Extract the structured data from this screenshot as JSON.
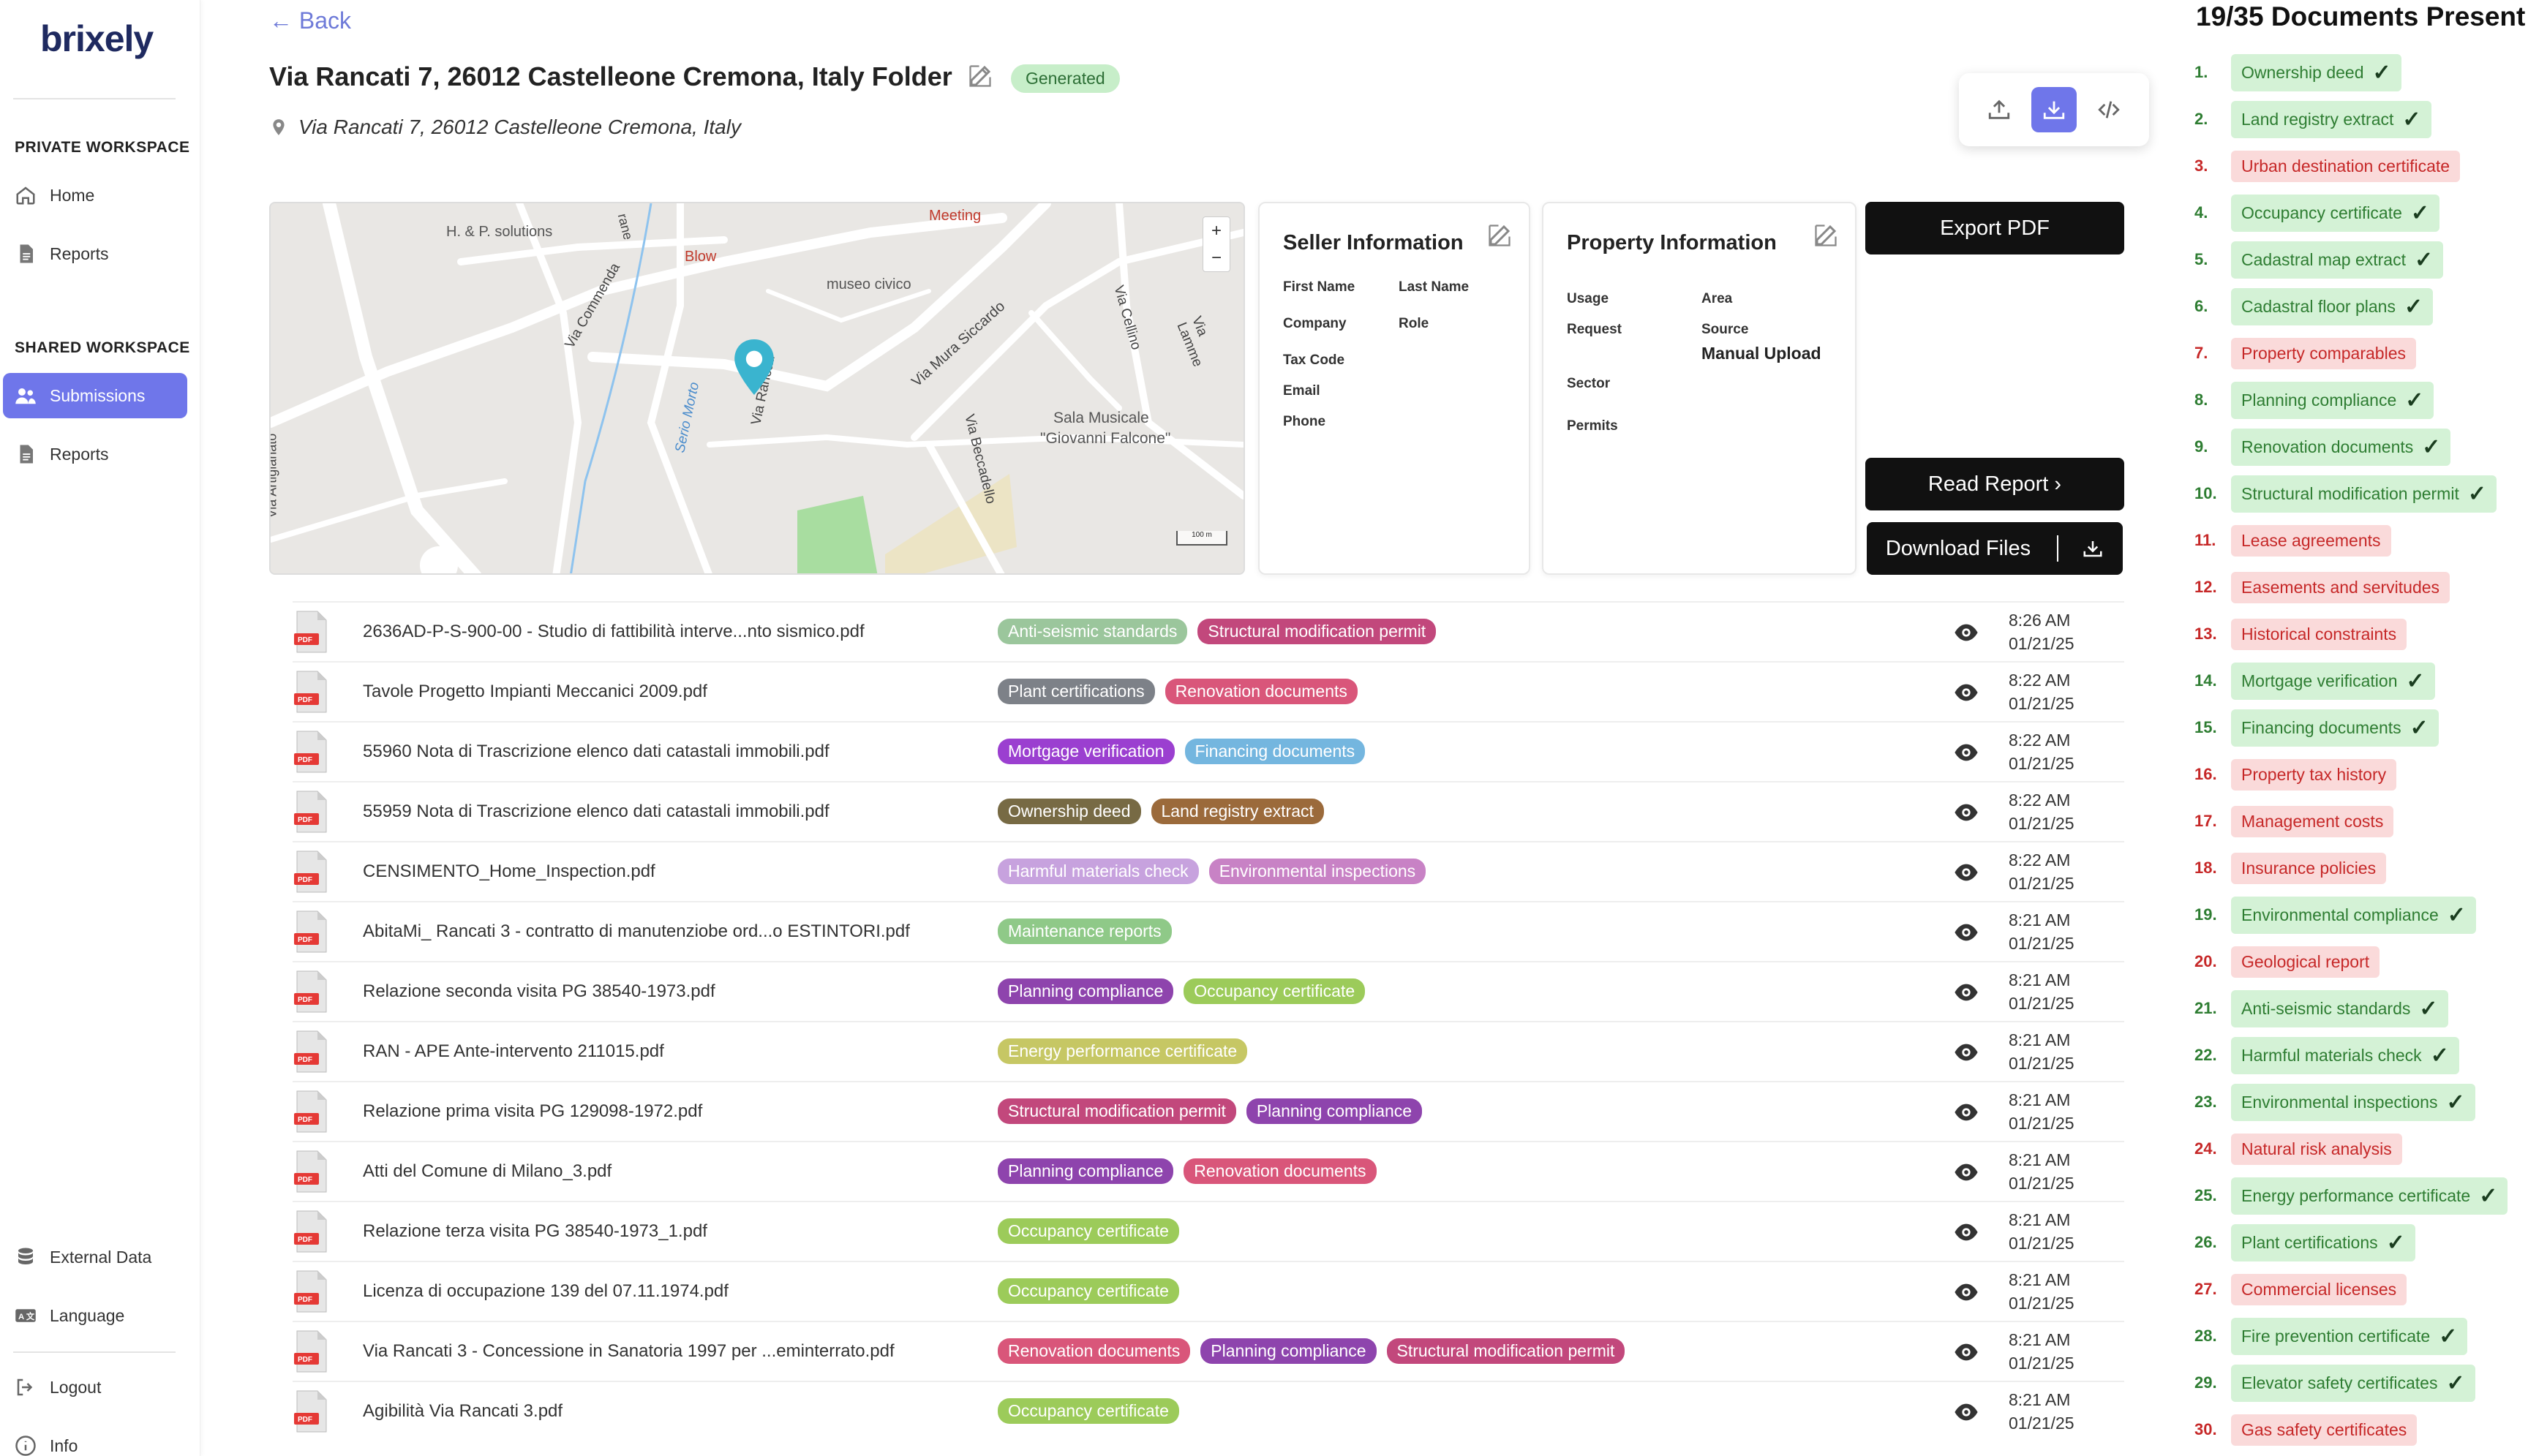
{
  "sidebar": {
    "logo": "brixely",
    "private_section": "PRIVATE WORKSPACE",
    "shared_section": "SHARED WORKSPACE",
    "items": [
      {
        "label": "Home",
        "icon": "home-icon"
      },
      {
        "label": "Reports",
        "icon": "document-icon"
      },
      {
        "label": "Submissions",
        "icon": "users-icon",
        "active": true
      },
      {
        "label": "Reports",
        "icon": "document-icon"
      }
    ],
    "bottom": [
      {
        "label": "External Data",
        "icon": "database-icon"
      },
      {
        "label": "Language",
        "icon": "translate-icon"
      },
      {
        "label": "Logout",
        "icon": "logout-icon"
      },
      {
        "label": "Info",
        "icon": "info-icon"
      }
    ]
  },
  "header": {
    "back": "← Back",
    "title": "Via Rancati 7, 26012 Castelleone Cremona, Italy Folder",
    "status": "Generated",
    "address": "Via Rancati 7, 26012 Castelleone Cremona, Italy"
  },
  "map_labels": {
    "poi1": "H. & P. solutions",
    "poi2": "Blow",
    "poi3": "Meeting",
    "poi4": "museo civico",
    "poi5": "Sala Musicale",
    "poi6": "\"Giovanni Falcone\"",
    "street1": "Via Commenda",
    "street2": "Seriо Morto",
    "street3": "Via Rancati",
    "street4": "Via Mura Siccardo",
    "street5": "Via Cellino",
    "street6": "Via Lamme",
    "street7": "Via Beccadello",
    "street8": "Via Artigianato",
    "street9": "rane",
    "scale": "100 m",
    "zoom_in": "+",
    "zoom_out": "−"
  },
  "seller": {
    "title": "Seller Information",
    "first_name": "First Name",
    "last_name": "Last Name",
    "company": "Company",
    "role": "Role",
    "tax_code": "Tax Code",
    "email": "Email",
    "phone": "Phone"
  },
  "property": {
    "title": "Property Information",
    "usage": "Usage",
    "area": "Area",
    "request": "Request",
    "source": "Source",
    "source_value": "Manual Upload",
    "sector": "Sector",
    "permits": "Permits"
  },
  "actions": {
    "export_pdf": "Export PDF",
    "read_report": "Read Report ›",
    "download_files": "Download Files"
  },
  "documents": [
    {
      "name": "2636AD-P-S-900-00 - Studio di fattibilità interve...nto sismico.pdf",
      "tags": [
        {
          "label": "Anti-seismic standards",
          "color": "#9bc69c"
        },
        {
          "label": "Structural modification permit",
          "color": "#c2487c"
        }
      ],
      "time": "8:26 AM",
      "date": "01/21/25"
    },
    {
      "name": "Tavole Progetto Impianti Meccanici 2009.pdf",
      "tags": [
        {
          "label": "Plant certifications",
          "color": "#7d8188"
        },
        {
          "label": "Renovation documents",
          "color": "#d9567a"
        }
      ],
      "time": "8:22 AM",
      "date": "01/21/25"
    },
    {
      "name": "55960 Nota di Trascrizione elenco dati catastali immobili.pdf",
      "tags": [
        {
          "label": "Mortgage verification",
          "color": "#9b3fd0"
        },
        {
          "label": "Financing documents",
          "color": "#74b6df"
        }
      ],
      "time": "8:22 AM",
      "date": "01/21/25"
    },
    {
      "name": "55959 Nota di Trascrizione elenco dati catastali immobili.pdf",
      "tags": [
        {
          "label": "Ownership deed",
          "color": "#776a44"
        },
        {
          "label": "Land registry extract",
          "color": "#9b6a3b"
        }
      ],
      "time": "8:22 AM",
      "date": "01/21/25"
    },
    {
      "name": "CENSIMENTO_Home_Inspection.pdf",
      "tags": [
        {
          "label": "Harmful materials check",
          "color": "#c7a2de"
        },
        {
          "label": "Environmental inspections",
          "color": "#c882c5"
        }
      ],
      "time": "8:22 AM",
      "date": "01/21/25"
    },
    {
      "name": "AbitaMi_ Rancati 3 - contratto di manutenziobe ord...o ESTINTORI.pdf",
      "tags": [
        {
          "label": "Maintenance reports",
          "color": "#8fc988"
        }
      ],
      "time": "8:21 AM",
      "date": "01/21/25"
    },
    {
      "name": "Relazione seconda visita PG 38540-1973.pdf",
      "tags": [
        {
          "label": "Planning compliance",
          "color": "#8e44ad"
        },
        {
          "label": "Occupancy certificate",
          "color": "#9ccb5a"
        }
      ],
      "time": "8:21 AM",
      "date": "01/21/25"
    },
    {
      "name": "RAN - APE Ante-intervento 211015.pdf",
      "tags": [
        {
          "label": "Energy performance certificate",
          "color": "#c6c764"
        }
      ],
      "time": "8:21 AM",
      "date": "01/21/25"
    },
    {
      "name": "Relazione prima visita PG 129098-1972.pdf",
      "tags": [
        {
          "label": "Structural modification permit",
          "color": "#c2487c"
        },
        {
          "label": "Planning compliance",
          "color": "#8e44ad"
        }
      ],
      "time": "8:21 AM",
      "date": "01/21/25"
    },
    {
      "name": "Atti del Comune di Milano_3.pdf",
      "tags": [
        {
          "label": "Planning compliance",
          "color": "#8e44ad"
        },
        {
          "label": "Renovation documents",
          "color": "#d9567a"
        }
      ],
      "time": "8:21 AM",
      "date": "01/21/25"
    },
    {
      "name": "Relazione terza visita PG 38540-1973_1.pdf",
      "tags": [
        {
          "label": "Occupancy certificate",
          "color": "#9ccb5a"
        }
      ],
      "time": "8:21 AM",
      "date": "01/21/25"
    },
    {
      "name": "Licenza di occupazione 139 del 07.11.1974.pdf",
      "tags": [
        {
          "label": "Occupancy certificate",
          "color": "#9ccb5a"
        }
      ],
      "time": "8:21 AM",
      "date": "01/21/25"
    },
    {
      "name": "Via Rancati 3 - Concessione in Sanatoria 1997 per ...eminterrato.pdf",
      "tags": [
        {
          "label": "Renovation documents",
          "color": "#d9567a"
        },
        {
          "label": "Planning compliance",
          "color": "#8e44ad"
        },
        {
          "label": "Structural modification permit",
          "color": "#c2487c"
        }
      ],
      "time": "8:21 AM",
      "date": "01/21/25"
    },
    {
      "name": "Agibilità Via Rancati 3.pdf",
      "tags": [
        {
          "label": "Occupancy certificate",
          "color": "#9ccb5a"
        }
      ],
      "time": "8:21 AM",
      "date": "01/21/25"
    }
  ],
  "checklist": {
    "title": "19/35 Documents Present",
    "items": [
      {
        "num": "1.",
        "label": "Ownership deed",
        "present": true
      },
      {
        "num": "2.",
        "label": "Land registry extract",
        "present": true
      },
      {
        "num": "3.",
        "label": "Urban destination certificate",
        "present": false
      },
      {
        "num": "4.",
        "label": "Occupancy certificate",
        "present": true
      },
      {
        "num": "5.",
        "label": "Cadastral map extract",
        "present": true
      },
      {
        "num": "6.",
        "label": "Cadastral floor plans",
        "present": true
      },
      {
        "num": "7.",
        "label": "Property comparables",
        "present": false
      },
      {
        "num": "8.",
        "label": "Planning compliance",
        "present": true
      },
      {
        "num": "9.",
        "label": "Renovation documents",
        "present": true
      },
      {
        "num": "10.",
        "label": "Structural modification permit",
        "present": true
      },
      {
        "num": "11.",
        "label": "Lease agreements",
        "present": false
      },
      {
        "num": "12.",
        "label": "Easements and servitudes",
        "present": false
      },
      {
        "num": "13.",
        "label": "Historical constraints",
        "present": false
      },
      {
        "num": "14.",
        "label": "Mortgage verification",
        "present": true
      },
      {
        "num": "15.",
        "label": "Financing documents",
        "present": true
      },
      {
        "num": "16.",
        "label": "Property tax history",
        "present": false
      },
      {
        "num": "17.",
        "label": "Management costs",
        "present": false
      },
      {
        "num": "18.",
        "label": "Insurance policies",
        "present": false
      },
      {
        "num": "19.",
        "label": "Environmental compliance",
        "present": true
      },
      {
        "num": "20.",
        "label": "Geological report",
        "present": false
      },
      {
        "num": "21.",
        "label": "Anti-seismic standards",
        "present": true
      },
      {
        "num": "22.",
        "label": "Harmful materials check",
        "present": true
      },
      {
        "num": "23.",
        "label": "Environmental inspections",
        "present": true
      },
      {
        "num": "24.",
        "label": "Natural risk analysis",
        "present": false
      },
      {
        "num": "25.",
        "label": "Energy performance certificate",
        "present": true
      },
      {
        "num": "26.",
        "label": "Plant certifications",
        "present": true
      },
      {
        "num": "27.",
        "label": "Commercial licenses",
        "present": false
      },
      {
        "num": "28.",
        "label": "Fire prevention certificate",
        "present": true
      },
      {
        "num": "29.",
        "label": "Elevator safety certificates",
        "present": true
      },
      {
        "num": "30.",
        "label": "Gas safety certificates",
        "present": false
      }
    ]
  }
}
